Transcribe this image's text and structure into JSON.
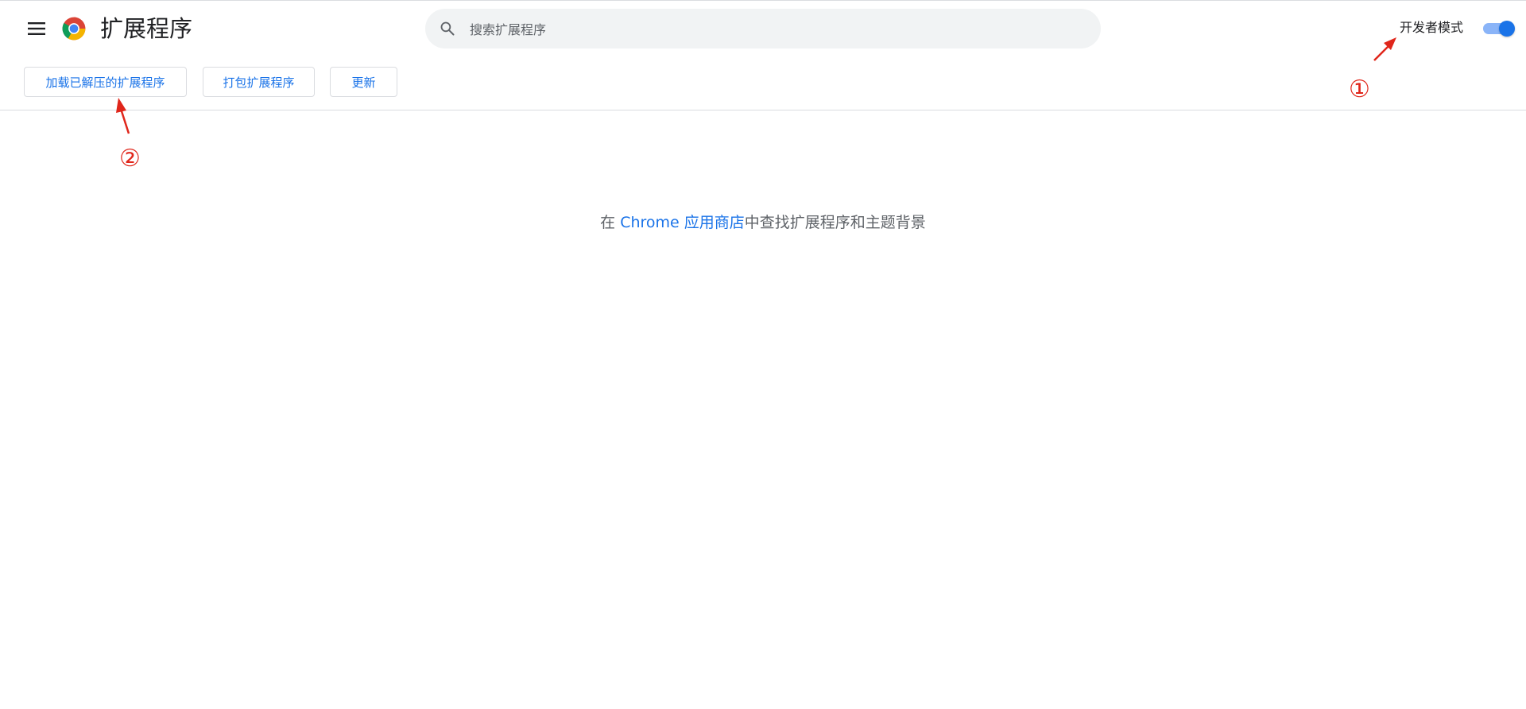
{
  "header": {
    "title": "扩展程序",
    "menu_icon": "hamburger-menu-icon",
    "logo_icon": "chrome-logo-icon"
  },
  "search": {
    "placeholder": "搜索扩展程序",
    "icon": "search-icon"
  },
  "developer_mode": {
    "label": "开发者模式",
    "enabled": true
  },
  "toolbar": {
    "load_unpacked_label": "加载已解压的扩展程序",
    "pack_label": "打包扩展程序",
    "update_label": "更新"
  },
  "empty_state": {
    "prefix": "在 ",
    "link_text": "Chrome 应用商店",
    "suffix": "中查找扩展程序和主题背景"
  },
  "annotations": {
    "step_1": "①",
    "step_2": "②",
    "color": "#e0261b"
  },
  "colors": {
    "accent": "#1a73e8",
    "toggle_track": "#8ab4f8",
    "search_bg": "#f1f3f4",
    "divider": "#dadce0"
  }
}
